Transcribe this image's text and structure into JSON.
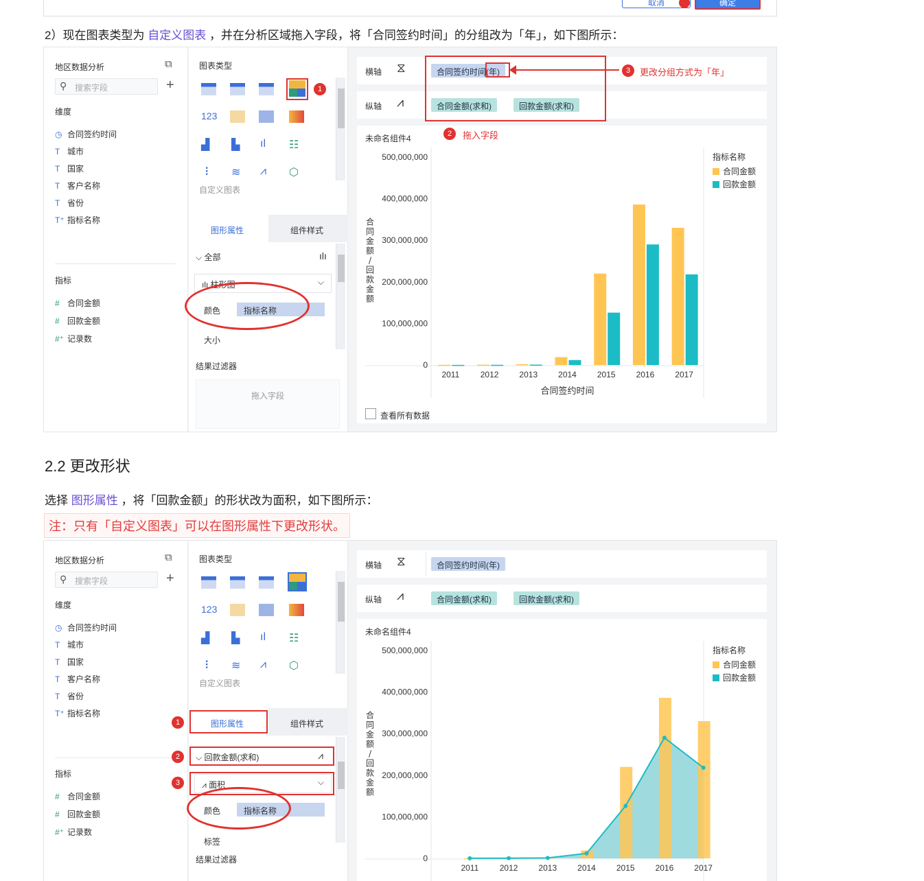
{
  "doc": {
    "step2_prefix": "2）现在图表类型为",
    "step2_link": "自定义图表",
    "step2_suffix": "，并在分析区域拖入字段，将「合同签约时间」的分组改为「年」，如下图所示：",
    "section_title": "2.2 更改形状",
    "select_prefix": "选择",
    "select_link": "图形属性",
    "select_suffix": "，将「回款金额」的形状改为面积，如下图所示：",
    "note": "注：只有「自定义图表」可以在图形属性下更改形状。",
    "top_button_cancel": "取消",
    "top_button_ok": "确定"
  },
  "editor": {
    "dataset_title": "地区数据分析",
    "search_placeholder": "搜索字段",
    "dimension_header": "维度",
    "dimensions": [
      {
        "icon": "clock-icon",
        "glyph": "◷",
        "label": "合同签约时间"
      },
      {
        "icon": "text-icon",
        "glyph": "T",
        "label": "城市"
      },
      {
        "icon": "text-icon",
        "glyph": "T",
        "label": "国家"
      },
      {
        "icon": "text-icon",
        "glyph": "T",
        "label": "客户名称"
      },
      {
        "icon": "text-icon",
        "glyph": "T",
        "label": "省份"
      },
      {
        "icon": "text-plus-icon",
        "glyph": "T⁺",
        "label": "指标名称"
      }
    ],
    "measure_header": "指标",
    "measures": [
      {
        "icon": "hash-icon",
        "glyph": "#",
        "label": "合同金额"
      },
      {
        "icon": "hash-icon",
        "glyph": "#",
        "label": "回款金额"
      },
      {
        "icon": "hash-plus-icon",
        "glyph": "#⁺",
        "label": "记录数"
      }
    ],
    "chart_type_header": "图表类型",
    "custom_chart_label": "自定义图表",
    "tab_shape": "图形属性",
    "tab_style": "组件样式",
    "all_label": "全部",
    "bar_label": "柱形图",
    "color_label": "颜色",
    "color_pill": "指标名称",
    "size_label": "大小",
    "result_filter": "结果过滤器",
    "drop_field": "拖入字段",
    "x_axis_label": "横轴",
    "y_axis_label": "纵轴",
    "x_pill": "合同签约时间(年)",
    "y_pill_1": "合同金额(求和)",
    "y_pill_2": "回款金额(求和)",
    "component_name": "未命名组件4",
    "view_all_data": "查看所有数据",
    "series_dropdown": "回款金额(求和)",
    "area_label": "面积",
    "label_label": "标签"
  },
  "annotations": {
    "ann1_num": "1",
    "ann2_num": "2",
    "ann2_text": "拖入字段",
    "ann3_num": "3",
    "ann3_text": "更改分组方式为「年」",
    "b_num1": "1",
    "b_num2": "2",
    "b_num3": "3"
  },
  "colors": {
    "contract": "#ffc553",
    "payment": "#1bbcc6",
    "area_fill": "#8ed4d9",
    "annotation_red": "#e0322f",
    "link_purple": "#6a4fd1"
  },
  "chart_data": [
    {
      "type": "bar",
      "title": "未命名组件4",
      "xlabel": "合同签约时间",
      "ylabel": "合同金额/回款金额",
      "categories": [
        "2011",
        "2012",
        "2013",
        "2014",
        "2015",
        "2016",
        "2017"
      ],
      "series": [
        {
          "name": "合同金额",
          "values": [
            500000,
            800000,
            2000000,
            19000000,
            220000000,
            386000000,
            330000000
          ]
        },
        {
          "name": "回款金额",
          "values": [
            300000,
            500000,
            1000000,
            12000000,
            126000000,
            290000000,
            218000000
          ]
        }
      ],
      "ylim": [
        0,
        500000000
      ],
      "yticks": [
        "0",
        "100,000,000",
        "200,000,000",
        "300,000,000",
        "400,000,000",
        "500,000,000"
      ],
      "legend_title": "指标名称",
      "legend": "top-right"
    },
    {
      "type": "bar",
      "title": "未命名组件4",
      "xlabel": "",
      "ylabel": "合同金额/回款金额",
      "categories": [
        "2011",
        "2012",
        "2013",
        "2014",
        "2015",
        "2016",
        "2017"
      ],
      "series": [
        {
          "name": "合同金额",
          "values": [
            500000,
            800000,
            2000000,
            19000000,
            220000000,
            386000000,
            330000000
          ],
          "shape": "bar"
        },
        {
          "name": "回款金额",
          "values": [
            300000,
            500000,
            1000000,
            12000000,
            126000000,
            290000000,
            218000000
          ],
          "shape": "area"
        }
      ],
      "ylim": [
        0,
        500000000
      ],
      "yticks": [
        "0",
        "100,000,000",
        "200,000,000",
        "300,000,000",
        "400,000,000",
        "500,000,000"
      ],
      "legend_title": "指标名称",
      "legend": "top-right"
    }
  ]
}
